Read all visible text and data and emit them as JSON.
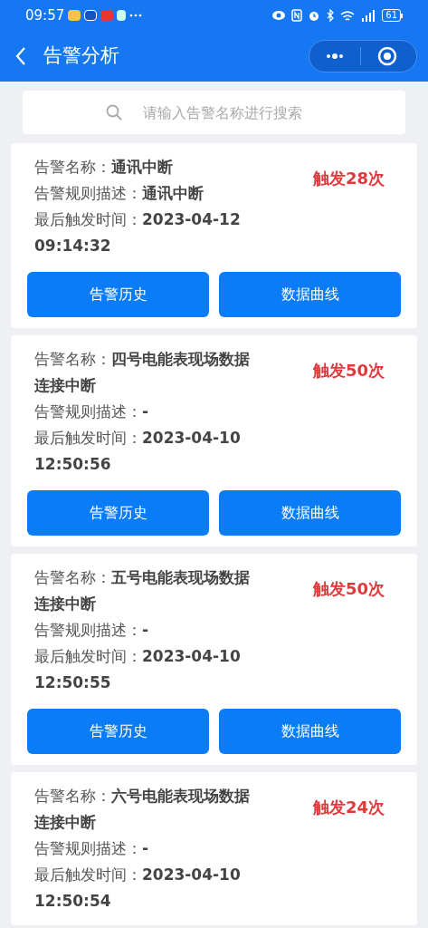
{
  "status_bar": {
    "time": "09:57",
    "battery": "61"
  },
  "header": {
    "title": "告警分析"
  },
  "search": {
    "placeholder": "请输入告警名称进行搜索"
  },
  "alarms": [
    {
      "name_label": "告警名称：",
      "name": "通讯中断",
      "rule_label": "告警规则描述：",
      "rule": "通讯中断",
      "time_label": "最后触发时间：",
      "time": "2023-04-12 09:14:32",
      "count": "触发28次",
      "buttons": [
        "告警历史",
        "数据曲线"
      ]
    },
    {
      "name_label": "告警名称：",
      "name": "四号电能表现场数据连接中断",
      "rule_label": "告警规则描述：",
      "rule": "-",
      "time_label": "最后触发时间：",
      "time": "2023-04-10 12:50:56",
      "count": "触发50次",
      "buttons": [
        "告警历史",
        "数据曲线"
      ]
    },
    {
      "name_label": "告警名称：",
      "name": "五号电能表现场数据连接中断",
      "rule_label": "告警规则描述：",
      "rule": "-",
      "time_label": "最后触发时间：",
      "time": "2023-04-10 12:50:55",
      "count": "触发50次",
      "buttons": [
        "告警历史",
        "数据曲线"
      ]
    },
    {
      "name_label": "告警名称：",
      "name": "六号电能表现场数据连接中断",
      "rule_label": "告警规则描述：",
      "rule": "-",
      "time_label": "最后触发时间：",
      "time": "2023-04-10 12:50:54",
      "count": "触发24次"
    }
  ]
}
